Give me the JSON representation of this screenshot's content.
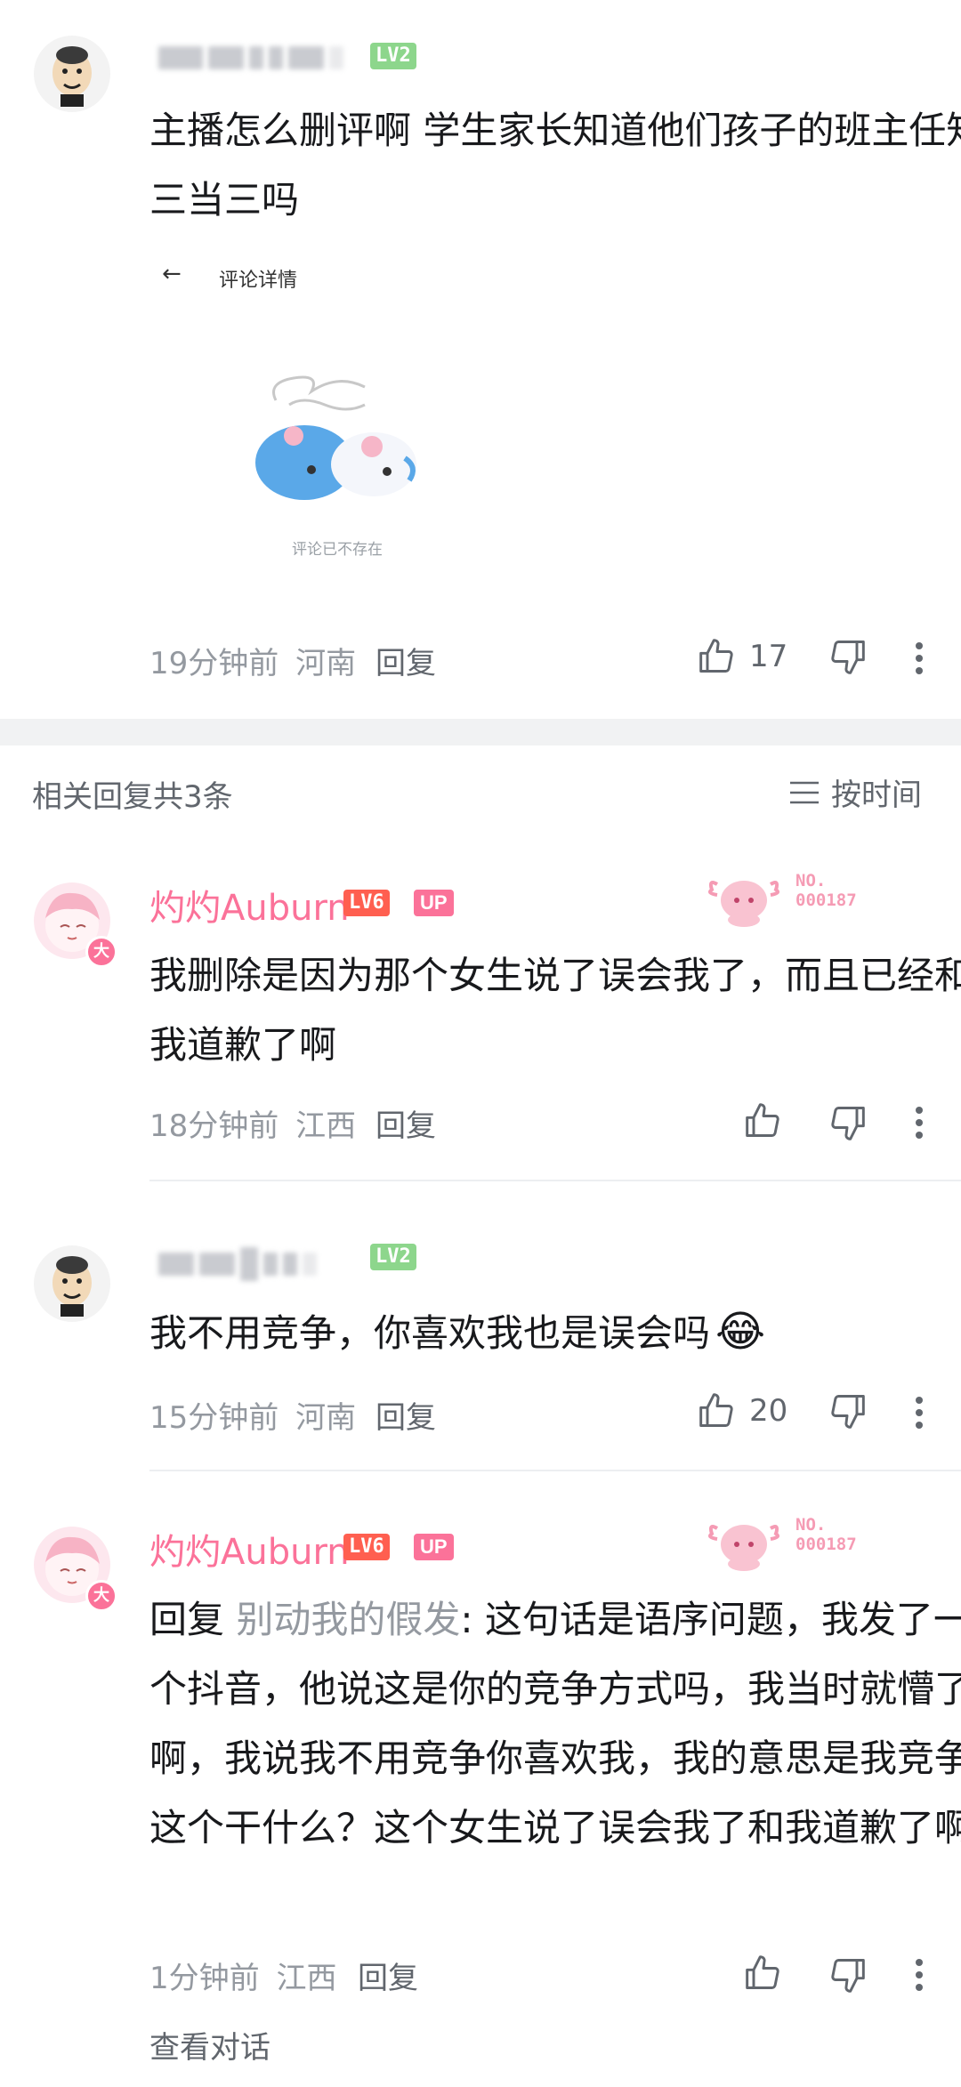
{
  "comment1": {
    "level": "LV2",
    "text": "主播怎么删评啊 学生家长知道他们孩子的班主任知三当三吗",
    "embed": {
      "back_label": "评论详情",
      "not_exist_text": "评论已不存在"
    },
    "time": "19分钟前",
    "location": "河南",
    "reply_label": "回复",
    "likes": "17"
  },
  "section": {
    "title": "相关回复共3条",
    "sort_label": "按时间"
  },
  "replies": [
    {
      "username": "灼灼Auburn",
      "level": "LV6",
      "up_badge": "UP",
      "fan_label_1": "NO.",
      "fan_label_2": "000187",
      "avatar_badge": "大",
      "text": "我删除是因为那个女生说了误会我了，而且已经和我道歉了啊",
      "time": "18分钟前",
      "location": "江西",
      "reply_label": "回复",
      "likes": ""
    },
    {
      "level": "LV2",
      "text": "我不用竞争，你喜欢我也是误会吗",
      "emoji": "😂",
      "time": "15分钟前",
      "location": "河南",
      "reply_label": "回复",
      "likes": "20"
    },
    {
      "username": "灼灼Auburn",
      "level": "LV6",
      "up_badge": "UP",
      "fan_label_1": "NO.",
      "fan_label_2": "000187",
      "avatar_badge": "大",
      "reply_prefix": "回复",
      "reply_target": "别动我的假发",
      "text": ": 这句话是语序问题，我发了一个抖音，他说这是你的竞争方式吗，我当时就懵了啊，我说我不用竞争你喜欢我，我的意思是我竞争这个干什么？这个女生说了误会我了和我道歉了啊",
      "time": "1分钟前",
      "location": "江西",
      "reply_label": "回复",
      "likes": ""
    }
  ],
  "view_conversation": "查看对话",
  "colors": {
    "pink": "#fb7299",
    "level_green": "#8dd68c",
    "level_red": "#ff5f50",
    "meta_gray": "#9499a0",
    "section_bg": "#f1f2f3"
  }
}
